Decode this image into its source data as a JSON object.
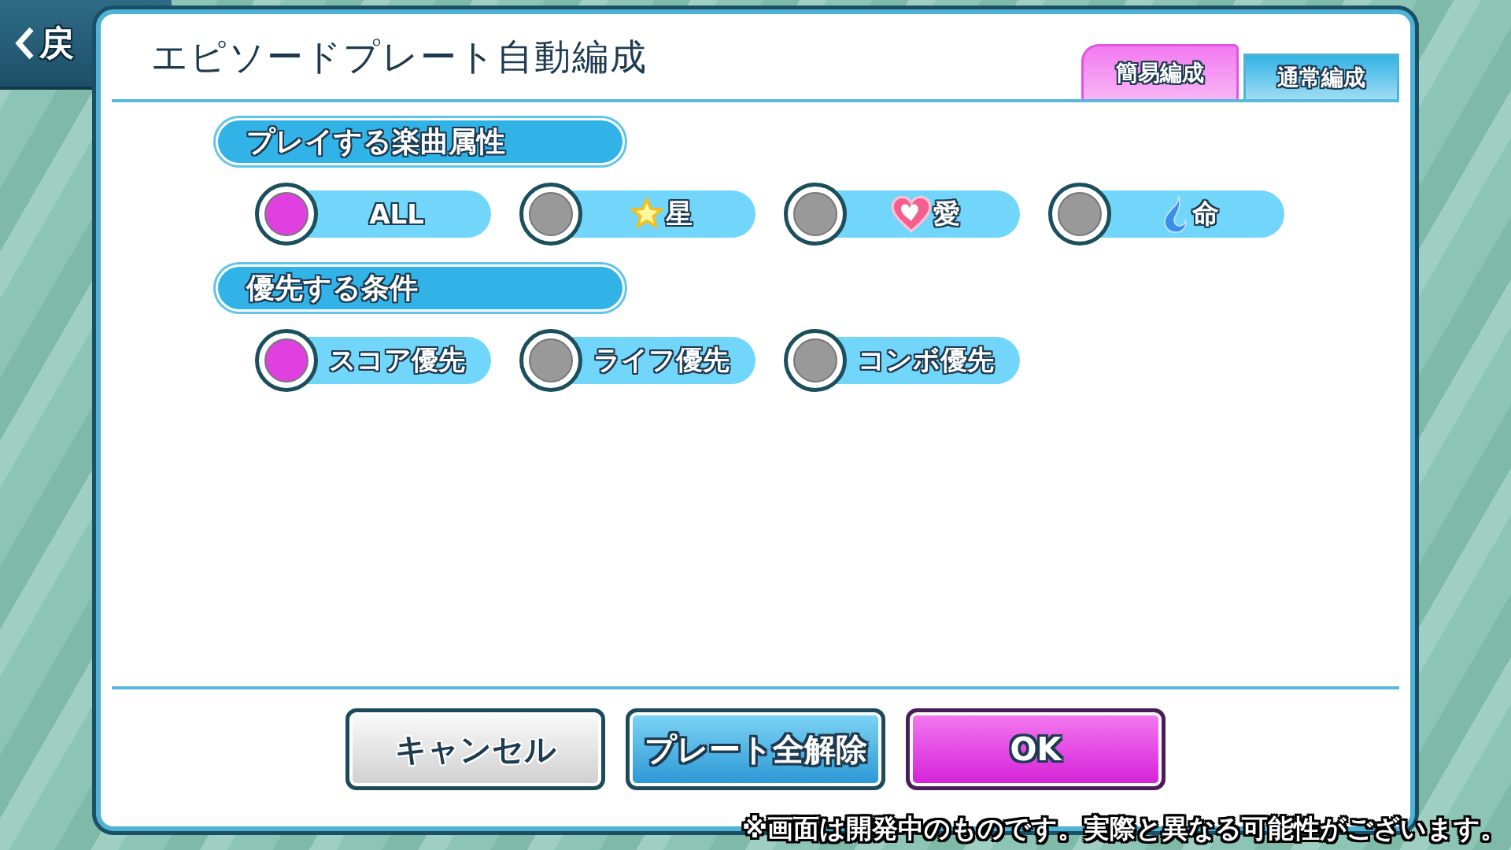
{
  "back_button": {
    "label": "戻"
  },
  "dialog": {
    "title": "エピソードプレート自動編成",
    "tabs": [
      {
        "label": "簡易編成",
        "selected": true
      },
      {
        "label": "通常編成",
        "selected": false
      }
    ],
    "sections": [
      {
        "heading": "プレイする楽曲属性",
        "options": [
          {
            "label": "ALL",
            "kind": "plain",
            "selected": true
          },
          {
            "label": "星",
            "kind": "star",
            "selected": false
          },
          {
            "label": "愛",
            "kind": "heart",
            "selected": false
          },
          {
            "label": "命",
            "kind": "flame",
            "selected": false
          }
        ]
      },
      {
        "heading": "優先する条件",
        "options": [
          {
            "label": "スコア優先",
            "kind": "plain",
            "selected": true
          },
          {
            "label": "ライフ優先",
            "kind": "plain",
            "selected": false
          },
          {
            "label": "コンボ優先",
            "kind": "plain",
            "selected": false
          }
        ]
      }
    ],
    "buttons": [
      {
        "label": "キャンセル",
        "kind": "cancel"
      },
      {
        "label": "プレート全解除",
        "kind": "clear"
      },
      {
        "label": "OK",
        "kind": "confirm"
      }
    ]
  },
  "notice": "※画面は開発中のものです。実際と異なる可能性がございます。"
}
